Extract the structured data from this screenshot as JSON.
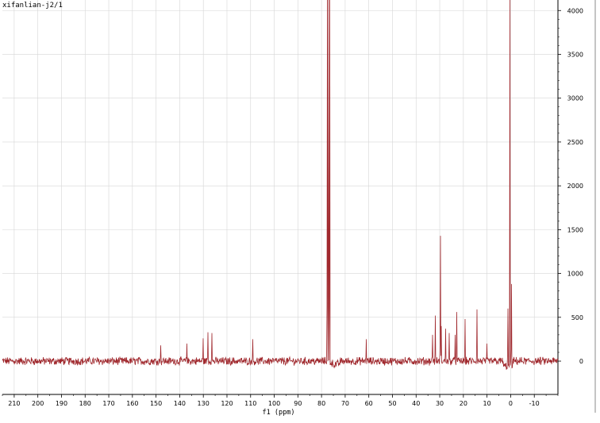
{
  "title": "xifanlian-j2/1",
  "chart_data": {
    "type": "line",
    "title": "xifanlian-j2/1",
    "xlabel": "f1 (ppm)",
    "ylabel": "",
    "x_reversed": true,
    "xlim": [
      -20,
      215
    ],
    "ylim": [
      -380,
      4120
    ],
    "x_ticks": [
      210,
      200,
      190,
      180,
      170,
      160,
      150,
      140,
      130,
      120,
      110,
      100,
      90,
      80,
      70,
      60,
      50,
      40,
      30,
      20,
      10,
      0,
      -10
    ],
    "x_tick_labels": [
      "210",
      "200",
      "190",
      "180",
      "170",
      "160",
      "150",
      "140",
      "130",
      "120",
      "110",
      "100",
      "90",
      "80",
      "70",
      "60",
      "50",
      "40",
      "30",
      "20",
      "10",
      "0",
      "-10"
    ],
    "y_ticks": [
      4000,
      3500,
      3000,
      2500,
      2000,
      1500,
      1000,
      500,
      0
    ],
    "y_tick_labels": [
      "4000",
      "3500",
      "3000",
      "2500",
      "2000",
      "1500",
      "1000",
      "500",
      "0"
    ],
    "y_axis_position": "right",
    "grid": true,
    "line_color": "#a0282d",
    "baseline_noise": 40,
    "peaks": [
      {
        "x": 77.5,
        "y": 4120
      },
      {
        "x": 77.0,
        "y": 4120
      },
      {
        "x": 76.6,
        "y": 4120
      },
      {
        "x": 0.3,
        "y": 4120
      },
      {
        "x": -0.3,
        "y": 880
      },
      {
        "x": 29.7,
        "y": 1430
      },
      {
        "x": 14.2,
        "y": 590
      },
      {
        "x": 22.8,
        "y": 560
      },
      {
        "x": 31.9,
        "y": 520
      },
      {
        "x": 19.3,
        "y": 480
      },
      {
        "x": 29.3,
        "y": 400
      },
      {
        "x": 27.5,
        "y": 370
      },
      {
        "x": 26.0,
        "y": 320
      },
      {
        "x": 33.0,
        "y": 300
      },
      {
        "x": 23.5,
        "y": 300
      },
      {
        "x": 128.0,
        "y": 330
      },
      {
        "x": 126.3,
        "y": 320
      },
      {
        "x": 130.0,
        "y": 260
      },
      {
        "x": 137.0,
        "y": 200
      },
      {
        "x": 109.0,
        "y": 250
      },
      {
        "x": 61.0,
        "y": 250
      },
      {
        "x": 10.0,
        "y": 200
      },
      {
        "x": 1.2,
        "y": 600
      },
      {
        "x": 148.0,
        "y": 180
      }
    ]
  }
}
